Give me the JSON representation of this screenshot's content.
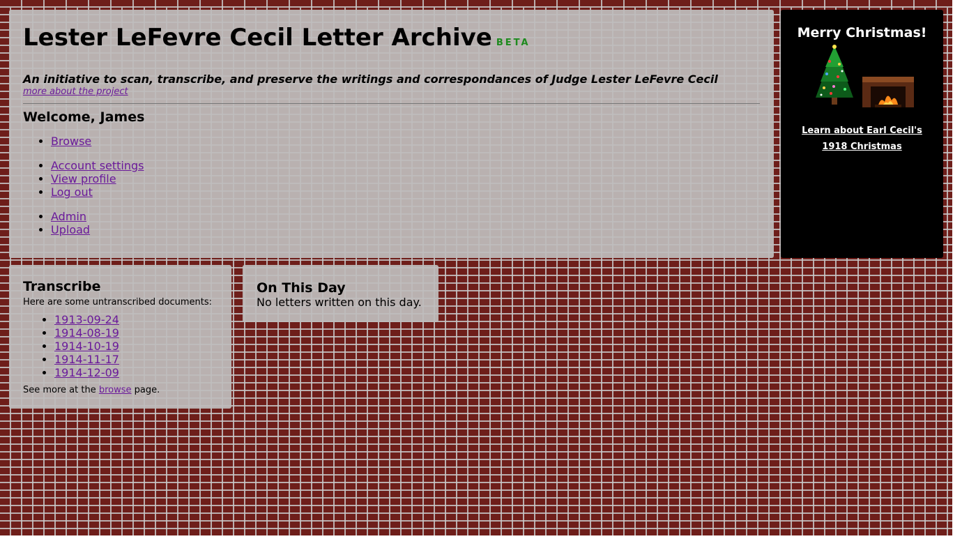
{
  "header": {
    "title": "Lester LeFevre Cecil Letter Archive",
    "beta": "BETA",
    "tagline": "An initiative to scan, transcribe, and preserve the writings and correspondances of Judge Lester LeFevre Cecil",
    "about_link": "more about the project",
    "welcome": "Welcome, James"
  },
  "nav": {
    "group1": [
      "Browse"
    ],
    "group2": [
      "Account settings",
      "View profile",
      "Log out"
    ],
    "group3": [
      "Admin",
      "Upload"
    ]
  },
  "xmas": {
    "title": "Merry Christmas!",
    "link": "Learn about Earl Cecil's 1918 Christmas"
  },
  "transcribe": {
    "title": "Transcribe",
    "intro": "Here are some untranscribed documents:",
    "documents": [
      "1913-09-24",
      "1914-08-19",
      "1914-10-19",
      "1914-11-17",
      "1914-12-09"
    ],
    "see_more_prefix": "See more at the",
    "see_more_link": "browse",
    "see_more_suffix": "page."
  },
  "on_this_day": {
    "title": "On This Day",
    "text": "No letters written on this day."
  },
  "colors": {
    "brick": "#6e1e1a",
    "panel": "#bebcbc",
    "link": "#6a1a9a",
    "beta": "#1e8a1e"
  }
}
